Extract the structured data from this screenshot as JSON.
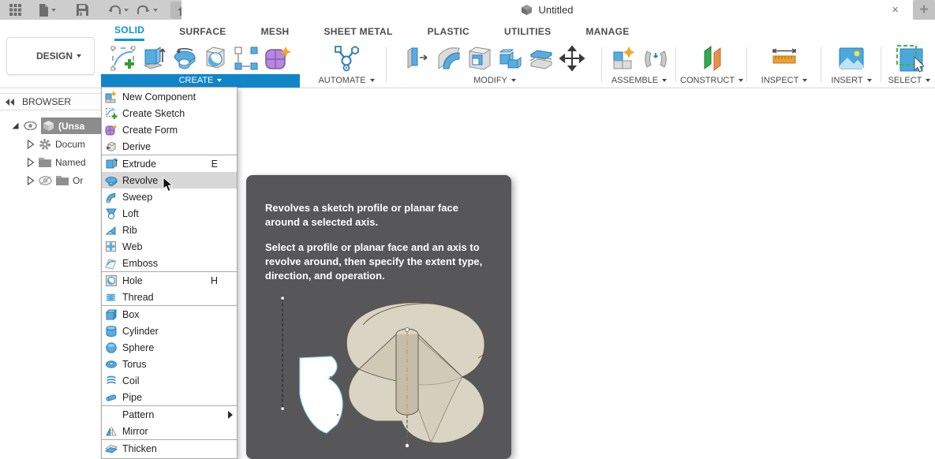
{
  "titlebar": {
    "title": "Untitled",
    "close_label": "×",
    "new_tab_label": "+"
  },
  "tabs": {
    "items": [
      {
        "label": "SOLID",
        "active": true
      },
      {
        "label": "SURFACE"
      },
      {
        "label": "MESH"
      },
      {
        "label": "SHEET METAL"
      },
      {
        "label": "PLASTIC"
      },
      {
        "label": "UTILITIES"
      },
      {
        "label": "MANAGE"
      }
    ]
  },
  "toolbar": {
    "design_label": "DESIGN",
    "groups": [
      {
        "label": "CREATE",
        "highlighted": true
      },
      {
        "label": "AUTOMATE"
      },
      {
        "label": "MODIFY"
      },
      {
        "label": "ASSEMBLE"
      },
      {
        "label": "CONSTRUCT"
      },
      {
        "label": "INSPECT"
      },
      {
        "label": "INSERT"
      },
      {
        "label": "SELECT"
      }
    ]
  },
  "browser": {
    "header": "BROWSER",
    "root_label": "(Unsa",
    "items": [
      {
        "label": "Docum"
      },
      {
        "label": "Named"
      },
      {
        "label": "Or"
      }
    ]
  },
  "menu": {
    "items": [
      {
        "label": "New Component"
      },
      {
        "label": "Create Sketch"
      },
      {
        "label": "Create Form"
      },
      {
        "label": "Derive"
      },
      {
        "label": "Extrude",
        "shortcut": "E"
      },
      {
        "label": "Revolve",
        "highlighted": true
      },
      {
        "label": "Sweep"
      },
      {
        "label": "Loft"
      },
      {
        "label": "Rib"
      },
      {
        "label": "Web"
      },
      {
        "label": "Emboss"
      },
      {
        "label": "Hole",
        "shortcut": "H"
      },
      {
        "label": "Thread"
      },
      {
        "label": "Box"
      },
      {
        "label": "Cylinder"
      },
      {
        "label": "Sphere"
      },
      {
        "label": "Torus"
      },
      {
        "label": "Coil"
      },
      {
        "label": "Pipe"
      },
      {
        "label": "Pattern",
        "has_submenu": true
      },
      {
        "label": "Mirror"
      },
      {
        "label": "Thicken"
      }
    ]
  },
  "tooltip": {
    "para1": "Revolves a sketch profile or planar face around a selected axis.",
    "para2": "Select a profile or planar face and an axis to revolve around, then specify the extent type, direction, and operation."
  },
  "colors": {
    "accent_blue": "#0696d7",
    "create_bar": "#1086c9",
    "menu_highlight": "#d7d7d7",
    "tooltip_bg": "#57575a",
    "icon_blue": "#58ade0",
    "browser_selection": "#8d8d8d"
  }
}
